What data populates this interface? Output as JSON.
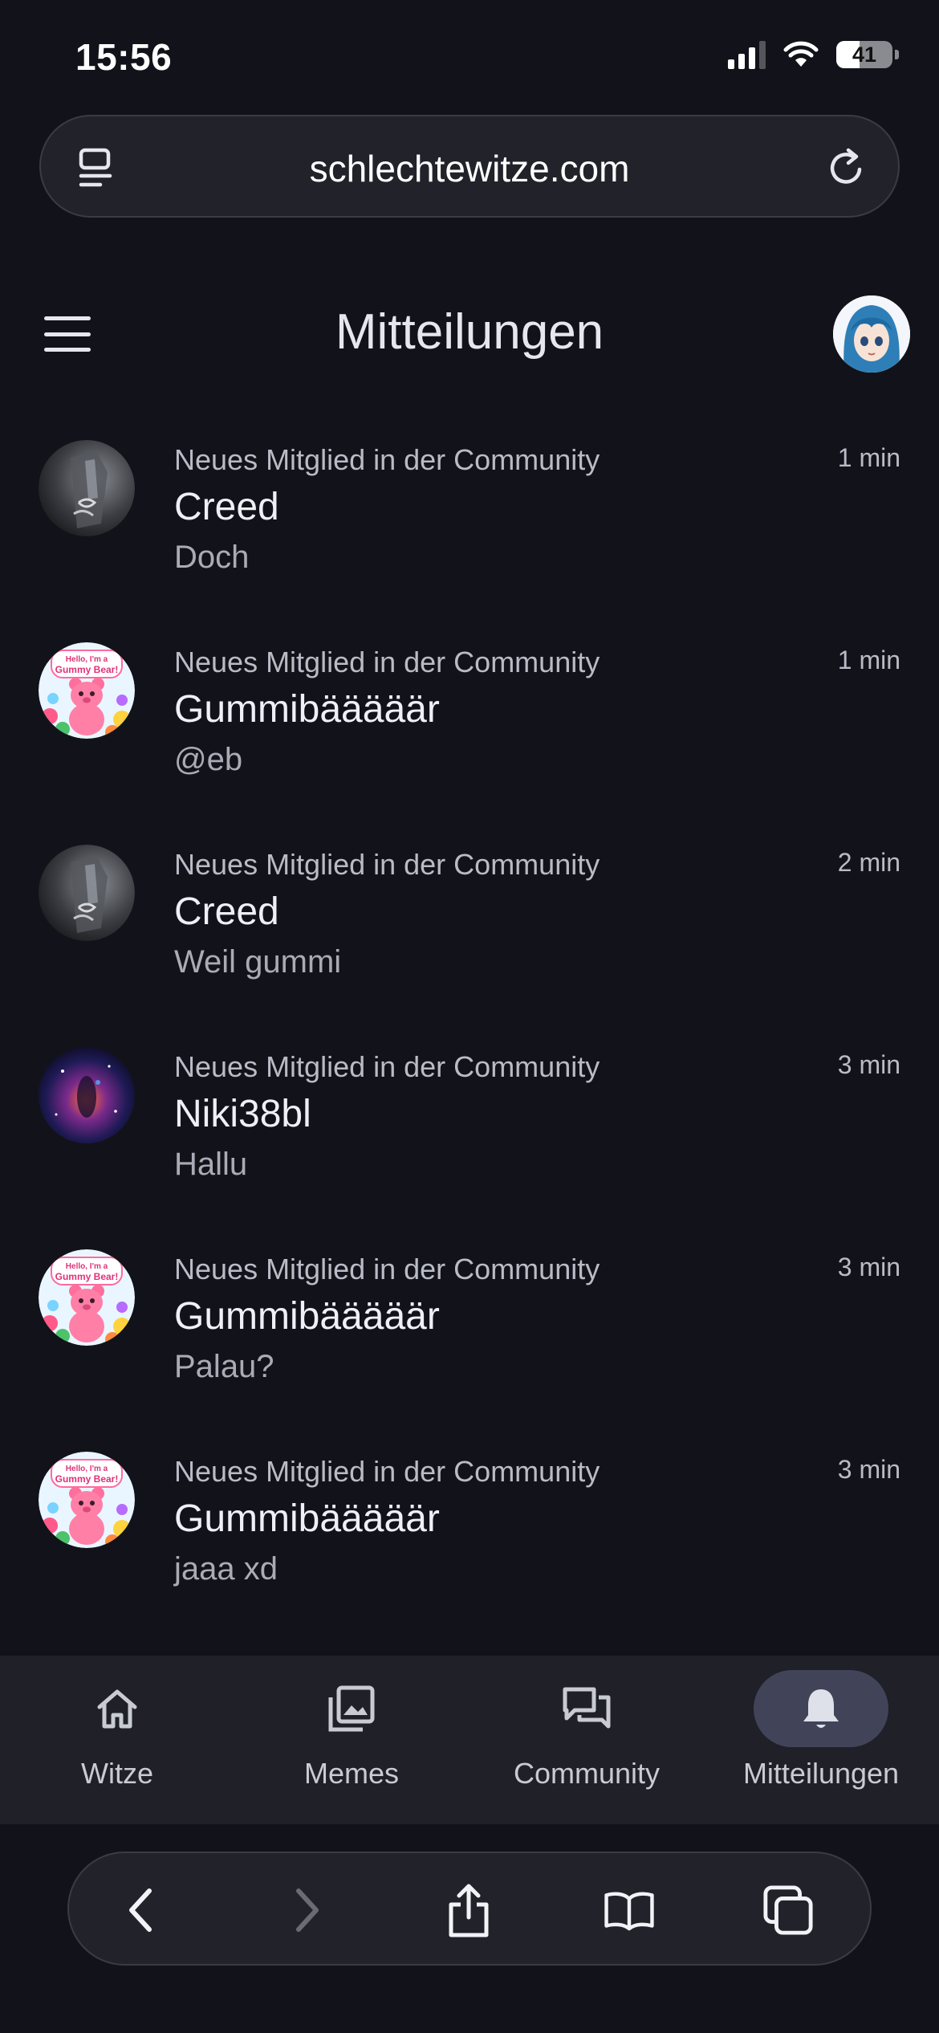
{
  "status_bar": {
    "time": "15:56",
    "battery": "41",
    "battery_level": 0.41
  },
  "browser": {
    "url": "schlechtewitze.com"
  },
  "header": {
    "title": "Mitteilungen"
  },
  "notifications": [
    {
      "category": "Neues Mitglied in der Community",
      "time": "1 min",
      "name": "Creed",
      "message": "Doch",
      "avatar": "creed"
    },
    {
      "category": "Neues Mitglied in der Community",
      "time": "1 min",
      "name": "Gummibääääär",
      "message": "@eb",
      "avatar": "gummy"
    },
    {
      "category": "Neues Mitglied in der Community",
      "time": "2 min",
      "name": "Creed",
      "message": "Weil gummi",
      "avatar": "creed"
    },
    {
      "category": "Neues Mitglied in der Community",
      "time": "3 min",
      "name": "Niki38bl",
      "message": "Hallu",
      "avatar": "galaxy"
    },
    {
      "category": "Neues Mitglied in der Community",
      "time": "3 min",
      "name": "Gummibääääär",
      "message": "Palau?",
      "avatar": "gummy"
    },
    {
      "category": "Neues Mitglied in der Community",
      "time": "3 min",
      "name": "Gummibääääär",
      "message": "jaaa xd",
      "avatar": "gummy"
    }
  ],
  "avatar_text": {
    "gummy_line1": "Hello, I'm a",
    "gummy_line2": "Gummy Bear!"
  },
  "bottom_nav": [
    {
      "label": "Witze",
      "icon": "home-icon",
      "active": false
    },
    {
      "label": "Memes",
      "icon": "image-gallery-icon",
      "active": false
    },
    {
      "label": "Community",
      "icon": "forum-icon",
      "active": false
    },
    {
      "label": "Mitteilungen",
      "icon": "bell-icon",
      "active": true
    }
  ],
  "colors": {
    "background": "#12131a",
    "nav_background": "#1f2028",
    "active_pill": "#414459",
    "muted_text": "#b9bbc6"
  }
}
